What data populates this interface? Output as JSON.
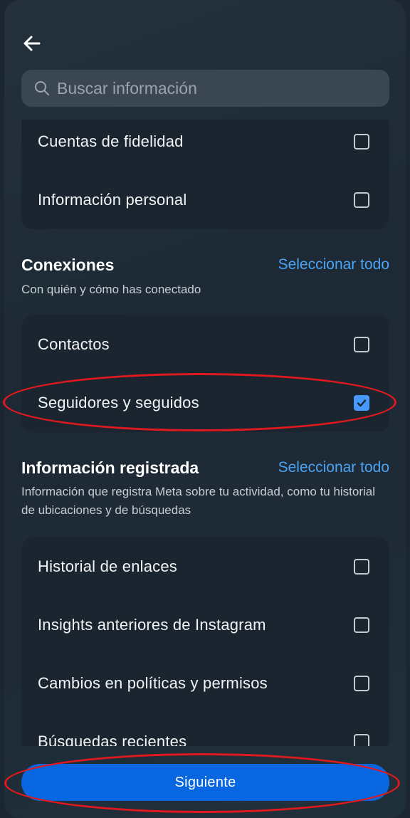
{
  "search": {
    "placeholder": "Buscar información"
  },
  "top_group": {
    "items": [
      {
        "label": "Cuentas de fidelidad",
        "checked": false
      },
      {
        "label": "Información personal",
        "checked": false
      }
    ]
  },
  "connections": {
    "title": "Conexiones",
    "select_all": "Seleccionar todo",
    "description": "Con quién y cómo has conectado",
    "items": [
      {
        "label": "Contactos",
        "checked": false
      },
      {
        "label": "Seguidores y seguidos",
        "checked": true
      }
    ]
  },
  "logged_info": {
    "title": "Información registrada",
    "select_all": "Seleccionar todo",
    "description": "Información que registra Meta sobre tu actividad, como tu historial de ubicaciones y de búsquedas",
    "items": [
      {
        "label": "Historial de enlaces",
        "checked": false
      },
      {
        "label": "Insights anteriores de Instagram",
        "checked": false
      },
      {
        "label": "Cambios en políticas y permisos",
        "checked": false
      },
      {
        "label": "Búsquedas recientes",
        "checked": false
      }
    ]
  },
  "footer": {
    "next_label": "Siguiente"
  },
  "colors": {
    "accent": "#0866e0",
    "link": "#4aa3f5",
    "checkbox_on": "#4599ff",
    "annotation": "#e0191f"
  }
}
